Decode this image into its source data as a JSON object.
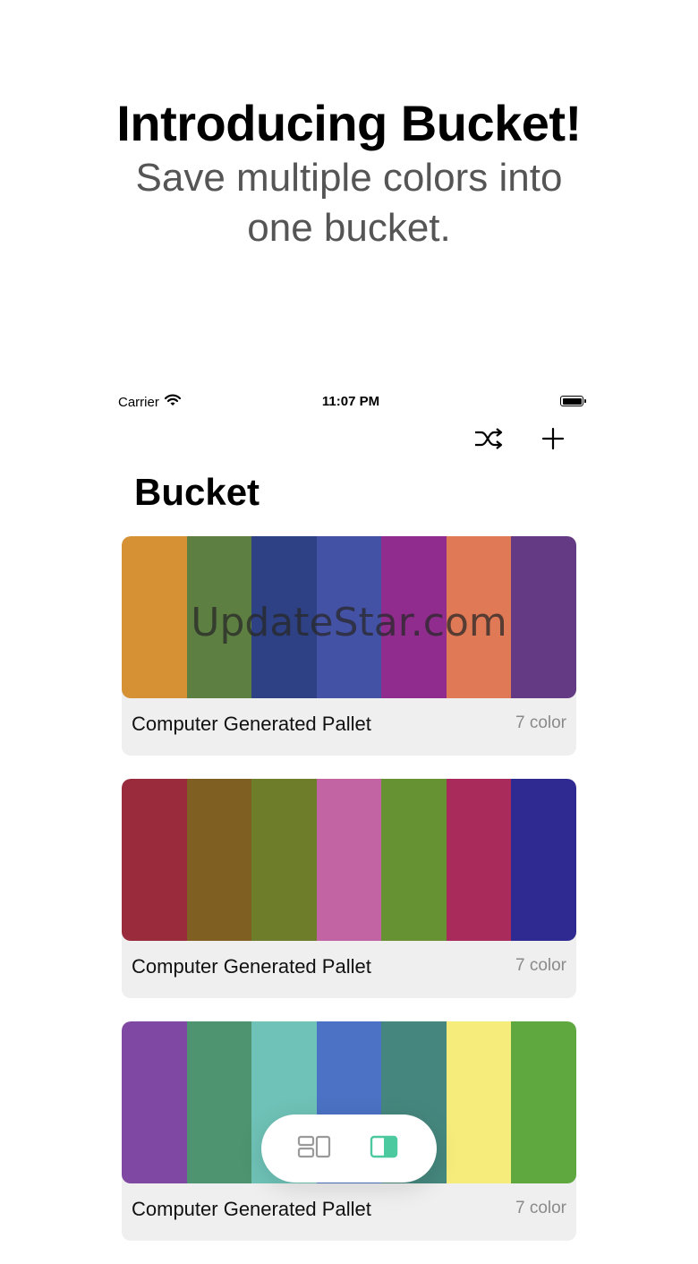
{
  "hero": {
    "title": "Introducing Bucket!",
    "subtitle": "Save multiple colors into one bucket."
  },
  "status_bar": {
    "carrier": "Carrier",
    "time": "11:07 PM"
  },
  "toolbar": {
    "shuffle_icon": "shuffle-icon",
    "add_icon": "plus-icon"
  },
  "page": {
    "title": "Bucket"
  },
  "watermark": "UpdateStar.com",
  "buckets": [
    {
      "name": "Computer Generated Pallet",
      "count": "7 color",
      "colors": [
        "#D69134",
        "#5E7F42",
        "#2E4184",
        "#4452A6",
        "#902C8E",
        "#E07A56",
        "#633A83"
      ]
    },
    {
      "name": "Computer Generated Pallet",
      "count": "7 color",
      "colors": [
        "#9A2B3D",
        "#7F5F22",
        "#6D7D2A",
        "#C264A3",
        "#679233",
        "#A92B5C",
        "#2E2A91"
      ]
    },
    {
      "name": "Computer Generated Pallet",
      "count": "7 color",
      "colors": [
        "#7F49A3",
        "#4E9470",
        "#6FC2B7",
        "#4B72C4",
        "#45877E",
        "#F6EC7B",
        "#5FA83F"
      ]
    }
  ],
  "view_switcher": {
    "grid_icon": "grid-view-icon",
    "list_icon": "list-view-icon",
    "active_color": "#4DC9A0",
    "inactive_color": "#9a9a9a"
  }
}
